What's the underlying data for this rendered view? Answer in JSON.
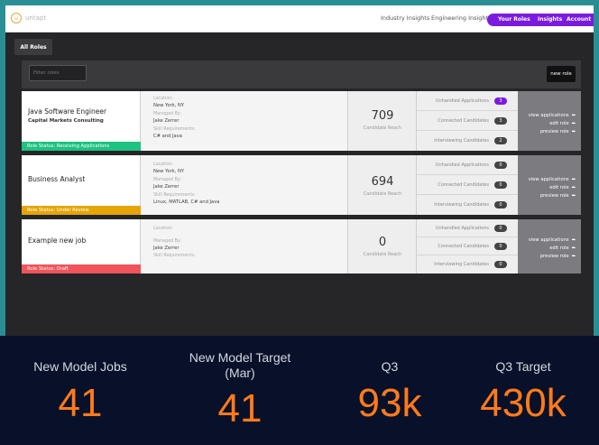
{
  "nav": {
    "logo_text": "untapt",
    "links": [
      "Industry Insights",
      "Engineering Insights"
    ],
    "pill_links": [
      "Your Roles",
      "Insights",
      "Account"
    ]
  },
  "tabs": {
    "all_roles": "All Roles"
  },
  "filter": {
    "placeholder": "Filter roles",
    "new_role": "new role"
  },
  "roles": [
    {
      "title": "Java Software Engineer",
      "company": "Capital Markets Consulting",
      "status": "Role Status: Receiving Applications",
      "status_color": "#1ec281",
      "location_label": "Location:",
      "location": "New York, NY",
      "managed_label": "Managed By:",
      "managed_by": "Jake Zerrer",
      "skills_label": "Skill Requirements:",
      "skills": "C# and Java",
      "reach": "709",
      "reach_label": "Candidate Reach",
      "counts": [
        {
          "label": "Unhandled Applications",
          "value": "3"
        },
        {
          "label": "Connected Candidates",
          "value": "3"
        },
        {
          "label": "Interviewing Candidates",
          "value": "2"
        }
      ],
      "actions": [
        "view applications",
        "edit role",
        "preview role"
      ]
    },
    {
      "title": "Business Analyst",
      "company": "",
      "status": "Role Status: Under Review",
      "status_color": "#e5a509",
      "location_label": "Location:",
      "location": "New York, NY",
      "managed_label": "Managed By:",
      "managed_by": "Jake Zerrer",
      "skills_label": "Skill Requirements:",
      "skills": "Linux, MATLAB, C# and Java",
      "reach": "694",
      "reach_label": "Candidate Reach",
      "counts": [
        {
          "label": "Unhandled Applications",
          "value": "0"
        },
        {
          "label": "Connected Candidates",
          "value": "0"
        },
        {
          "label": "Interviewing Candidates",
          "value": "0"
        }
      ],
      "actions": [
        "view applications",
        "edit role",
        "preview role"
      ]
    },
    {
      "title": "Example new job",
      "company": "",
      "status": "Role Status: Draft",
      "status_color": "#f0555b",
      "location_label": "Location:",
      "location": "",
      "managed_label": "Managed By:",
      "managed_by": "Jake Zerrer",
      "skills_label": "Skill Requirements:",
      "skills": "",
      "reach": "0",
      "reach_label": "Candidate Reach",
      "counts": [
        {
          "label": "Unhandled Applications",
          "value": "0"
        },
        {
          "label": "Connected Candidates",
          "value": "0"
        },
        {
          "label": "Interviewing Candidates",
          "value": "0"
        }
      ],
      "actions": [
        "view applications",
        "edit role",
        "preview role"
      ]
    }
  ],
  "stats": [
    {
      "label": "New Model Jobs",
      "value": "41"
    },
    {
      "label": "New Model Target (Mar)",
      "value": "41"
    },
    {
      "label": "Q3",
      "value": "93k"
    },
    {
      "label": "Q3 Target",
      "value": "430k"
    }
  ],
  "colors": {
    "accent": "#7b1be0",
    "stat_value": "#ff7a1a",
    "background": "#2a8f95"
  }
}
